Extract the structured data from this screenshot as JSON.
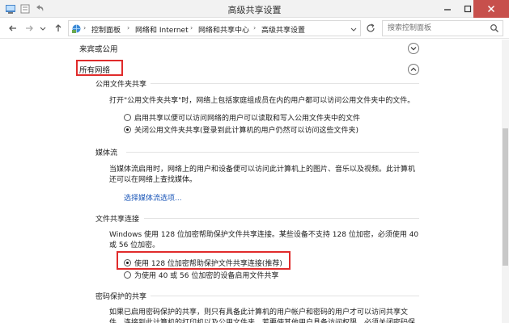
{
  "window": {
    "title": "高级共享设置"
  },
  "nav": {
    "breadcrumbs": [
      "控制面板",
      "网络和 Internet",
      "网络和共享中心",
      "高级共享设置"
    ],
    "search_placeholder": "搜索控制面板"
  },
  "profiles": {
    "guest_public": "来宾或公用",
    "all_networks": "所有网络"
  },
  "sections": {
    "public_folder": {
      "title": "公用文件夹共享",
      "desc": "打开\"公用文件夹共享\"时，网络上包括家庭组成员在内的用户都可以访问公用文件夹中的文件。",
      "options": [
        "启用共享以便可以访问网络的用户可以读取和写入公用文件夹中的文件",
        "关闭公用文件夹共享(登录到此计算机的用户仍然可以访问这些文件夹)"
      ]
    },
    "media": {
      "title": "媒体流",
      "desc": "当媒体流启用时，网络上的用户和设备便可以访问此计算机上的图片、音乐以及视频。此计算机还可以在网络上查找媒体。",
      "link": "选择媒体流选项..."
    },
    "file_sharing": {
      "title": "文件共享连接",
      "desc": "Windows 使用 128 位加密帮助保护文件共享连接。某些设备不支持 128 位加密，必须使用 40 或 56 位加密。",
      "options": [
        "使用 128 位加密帮助保护文件共享连接(推荐)",
        "为使用 40 或 56 位加密的设备启用文件共享"
      ]
    },
    "password": {
      "title": "密码保护的共享",
      "desc": "如果已启用密码保护的共享，则只有具备此计算机的用户帐户和密码的用户才可以访问共享文件、连接到此计算机的打印机以及公用文件夹。若要使其他用户具备访问权限，必须关闭密码保护的共享。"
    }
  }
}
